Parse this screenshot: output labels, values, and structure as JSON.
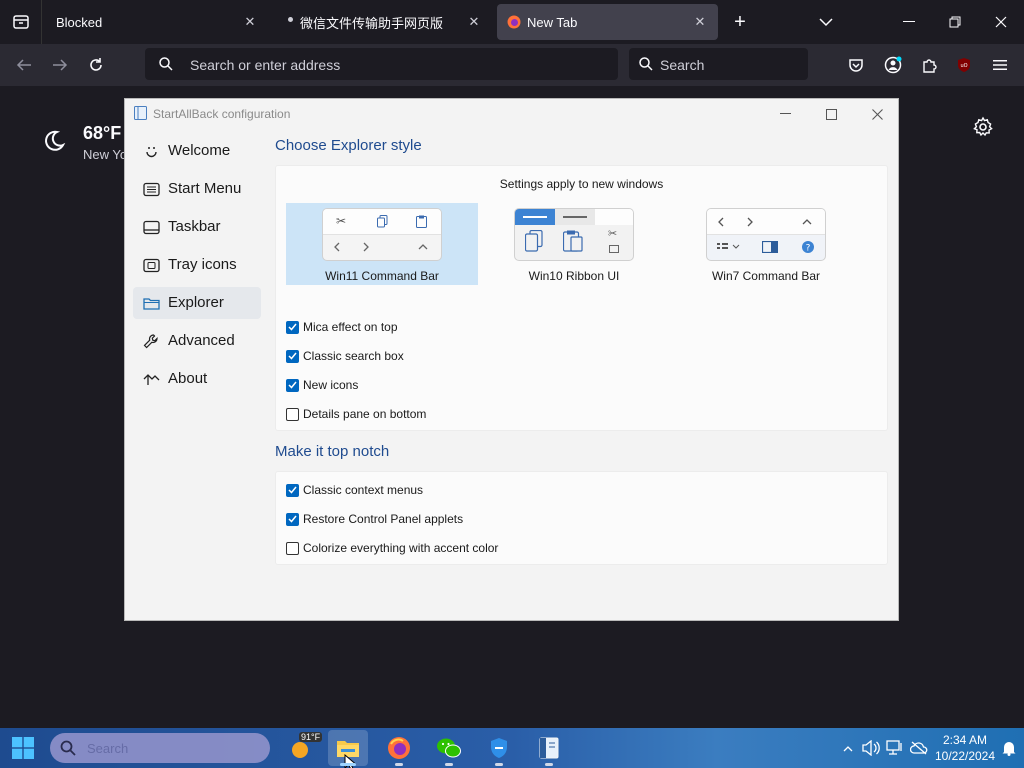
{
  "browser": {
    "tabs": [
      {
        "title": "Blocked"
      },
      {
        "title": "微信文件传输助手网页版"
      },
      {
        "title": "New Tab"
      }
    ],
    "url_placeholder": "Search or enter address",
    "search_placeholder": "Search"
  },
  "newtab": {
    "temperature": "68°F",
    "location": "New Yo"
  },
  "sab": {
    "title": "StartAllBack configuration",
    "nav": [
      {
        "label": "Welcome",
        "icon": "smiley-icon"
      },
      {
        "label": "Start Menu",
        "icon": "start-menu-icon"
      },
      {
        "label": "Taskbar",
        "icon": "taskbar-icon"
      },
      {
        "label": "Tray icons",
        "icon": "tray-icon"
      },
      {
        "label": "Explorer",
        "icon": "folder-icon",
        "selected": true
      },
      {
        "label": "Advanced",
        "icon": "wrench-icon"
      },
      {
        "label": "About",
        "icon": "about-icon"
      }
    ],
    "explorer_style": {
      "heading": "Choose Explorer style",
      "note": "Settings apply to new windows",
      "options": [
        {
          "label": "Win11 Command Bar",
          "selected": true
        },
        {
          "label": "Win10 Ribbon UI",
          "selected": false
        },
        {
          "label": "Win7 Command Bar",
          "selected": false
        }
      ],
      "checkboxes": [
        {
          "label": "Mica effect on top",
          "checked": true
        },
        {
          "label": "Classic search box",
          "checked": true
        },
        {
          "label": "New icons",
          "checked": true
        },
        {
          "label": "Details pane on bottom",
          "checked": false
        }
      ]
    },
    "top_notch": {
      "heading": "Make it top notch",
      "checkboxes": [
        {
          "label": "Classic context menus",
          "checked": true
        },
        {
          "label": "Restore Control Panel applets",
          "checked": true
        },
        {
          "label": "Colorize everything with accent color",
          "checked": false
        }
      ]
    }
  },
  "taskbar": {
    "search_placeholder": "Search",
    "weather_badge": "91°F",
    "time": "2:34 AM",
    "date": "10/22/2024"
  },
  "colors": {
    "accent": "#0067c0",
    "section_heading": "#1f4b8f",
    "selection": "#cce4f7"
  }
}
